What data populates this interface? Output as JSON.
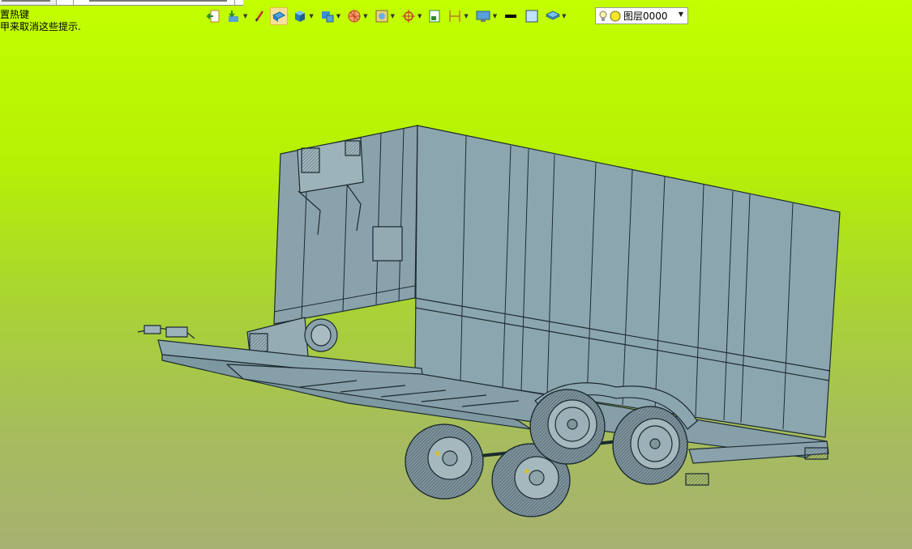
{
  "window": {
    "title_visible": ""
  },
  "hint": {
    "line1": "置热键",
    "line2": "甲来取消这些提示."
  },
  "toolbar": {
    "tools": [
      {
        "icon": "exit-icon",
        "dropdown": false
      },
      {
        "icon": "import-icon",
        "dropdown": true
      },
      {
        "icon": "pen-icon",
        "dropdown": false
      },
      {
        "icon": "surface-icon",
        "dropdown": false,
        "active": true
      },
      {
        "icon": "cube-icon",
        "dropdown": true
      },
      {
        "icon": "monitor-icon",
        "dropdown": true
      },
      {
        "icon": "wheel-icon",
        "dropdown": true
      },
      {
        "icon": "frame-icon",
        "dropdown": true
      },
      {
        "icon": "crosshair-icon",
        "dropdown": true
      },
      {
        "icon": "page-icon",
        "dropdown": false
      },
      {
        "icon": "dimension-icon",
        "dropdown": true
      },
      {
        "icon": "display-icon",
        "dropdown": true
      },
      {
        "icon": "line-color-icon",
        "dropdown": false
      },
      {
        "icon": "fill-color-icon",
        "dropdown": false
      },
      {
        "icon": "layers-icon",
        "dropdown": true
      }
    ],
    "colors": {
      "active_bg": "#f7e09a",
      "line_color": "#000000",
      "fill_color": "#bfe2ff"
    }
  },
  "layer": {
    "label": "图层0000",
    "bulb_icon": "light-bulb-icon",
    "dot_icon": "layer-color-dot-icon"
  },
  "viewport": {
    "background_top": "#c3ff00",
    "background_bottom": "#a7b171",
    "model_color": "#8aa4ad"
  }
}
